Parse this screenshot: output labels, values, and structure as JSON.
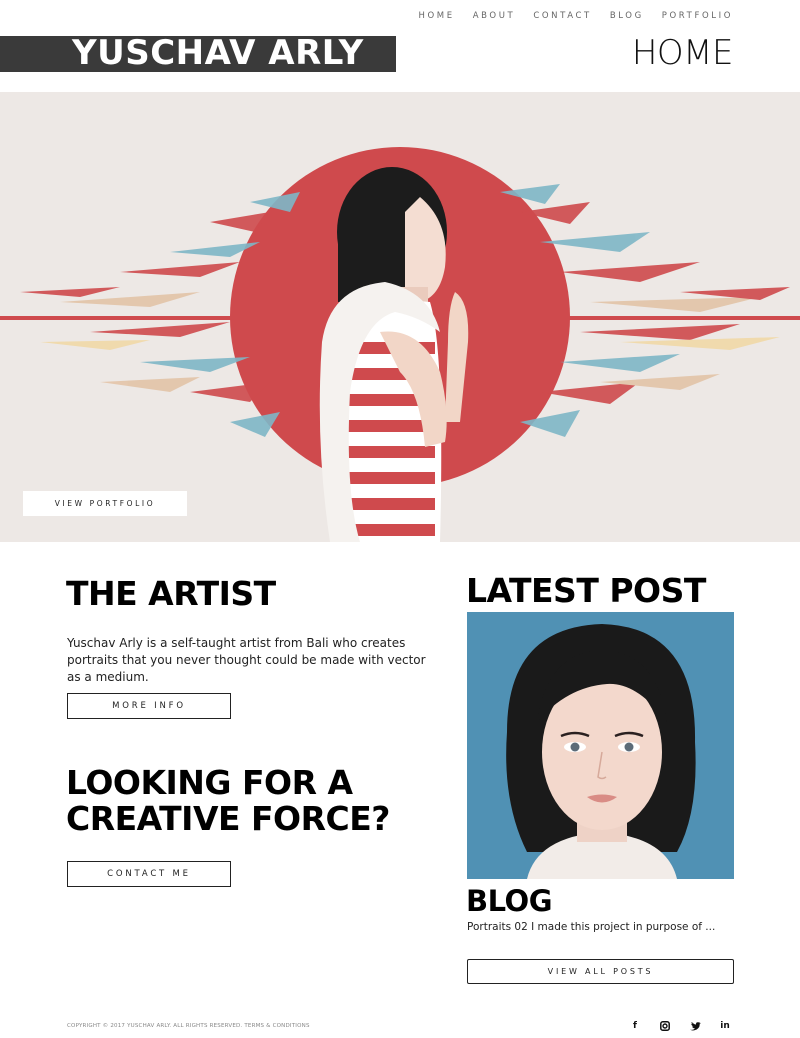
{
  "nav": {
    "items": [
      "HOME",
      "ABOUT",
      "CONTACT",
      "BLOG",
      "PORTFOLIO"
    ]
  },
  "header": {
    "logo": "YUSCHAV ARLY",
    "page_title": "HOME"
  },
  "hero": {
    "button_label": "VIEW PORTFOLIO"
  },
  "artist": {
    "title": "THE ARTIST",
    "description": "Yuschav Arly is a self-taught artist from Bali who creates portraits that you never thought could be made with vector as a medium.",
    "button_label": "MORE INFO"
  },
  "creative": {
    "title": "LOOKING FOR A CREATIVE FORCE?",
    "button_label": "CONTACT ME"
  },
  "latest": {
    "title": "LATEST POST",
    "blog_title": "BLOG",
    "excerpt": "Portraits 02 I made this project in purpose of ...",
    "button_label": "VIEW ALL POSTS"
  },
  "footer": {
    "copyright": "COPYRIGHT © 2017 YUSCHAV ARLY. ALL RIGHTS RESERVED. TERMS & CONDITIONS",
    "socials": [
      {
        "icon": "facebook-icon",
        "glyph": "f"
      },
      {
        "icon": "instagram-icon",
        "glyph": "◙"
      },
      {
        "icon": "twitter-icon",
        "glyph": "🐦"
      },
      {
        "icon": "linkedin-icon",
        "glyph": "in"
      }
    ]
  },
  "colors": {
    "accent_red": "#cf4a4d",
    "hero_bg": "#ede8e5",
    "post_bg": "#5091b4",
    "logo_bar": "#3a3a3a"
  }
}
